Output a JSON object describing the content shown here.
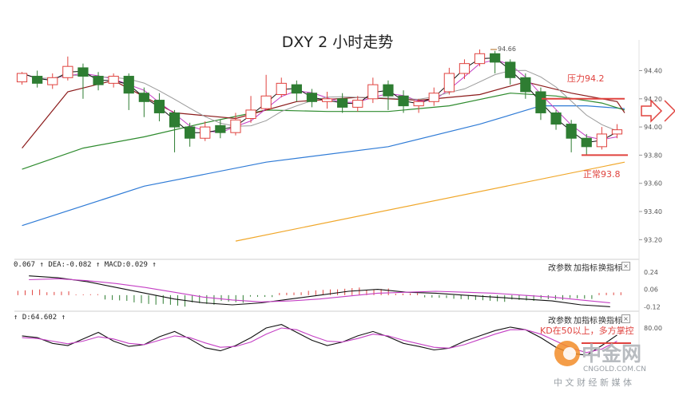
{
  "title": "DXY 2 小时走势",
  "macd_panel": {
    "values_text": "0.067 ↑ DEA:-0.082 ↑ MACD:0.029 ↑",
    "buttons": [
      "改参数",
      "加指标",
      "换指标"
    ],
    "close_symbol": "×",
    "ticks": [
      "0.24",
      "0.06",
      "-0.12"
    ]
  },
  "kd_panel": {
    "values_text": "↑ D:64.602 ↑",
    "buttons": [
      "改参数",
      "加指标",
      "换指标"
    ],
    "close_symbol": "×",
    "ticks": [
      "80.00"
    ]
  },
  "annotations": {
    "resistance": "压力94.2",
    "support": "正常93.8",
    "kd_note": "KD在50以上，多方掌控",
    "high_label": "94.66"
  },
  "watermark": {
    "brand": "中金网",
    "domain": "CNGOLD.COM.CN",
    "tagline": "中 文 财 经 新 媒 体"
  },
  "colors": {
    "up": "#e0433f",
    "down": "#2e7d32",
    "ma_blue": "#2f7bd6",
    "ma_orange": "#f0a72a",
    "ma_green": "#2e8b2e",
    "ma_dark_red": "#8b1a1a",
    "ma_pink": "#c43fc4",
    "ma_gray": "#9a9a9a",
    "annotation": "#e0433f"
  },
  "chart_data": {
    "type": "line",
    "title": "DXY 2 小时走势",
    "ylim": [
      93.1,
      94.55
    ],
    "y_ticks": [
      94.4,
      94.2,
      94.0,
      93.8,
      93.6,
      93.4,
      93.2
    ],
    "y_tick_labels": [
      "94.40",
      "94.20",
      "94.00",
      "93.80",
      "93.60",
      "93.40",
      "93.20"
    ],
    "series": [
      {
        "key": "ma_orange",
        "x": [
          14,
          40
        ],
        "values": [
          93.19,
          93.75
        ]
      },
      {
        "key": "ma_blue",
        "x": [
          0,
          8,
          16,
          24,
          30,
          34,
          37,
          40
        ],
        "values": [
          93.3,
          93.58,
          93.75,
          93.86,
          94.02,
          94.15,
          94.15,
          94.13
        ]
      },
      {
        "key": "ma_green",
        "x": [
          0,
          4,
          8,
          12,
          16,
          20,
          24,
          28,
          32,
          35,
          38,
          40
        ],
        "values": [
          93.7,
          93.85,
          93.93,
          94.03,
          94.12,
          94.11,
          94.11,
          94.15,
          94.24,
          94.22,
          94.17,
          94.12
        ]
      },
      {
        "key": "ma_dark_red",
        "x": [
          0,
          3,
          6,
          10,
          14,
          18,
          22,
          26,
          30,
          33,
          36,
          39,
          40
        ],
        "values": [
          93.85,
          94.25,
          94.33,
          94.1,
          94.06,
          94.18,
          94.21,
          94.19,
          94.23,
          94.32,
          94.24,
          94.18,
          94.1
        ]
      }
    ],
    "candles": [
      [
        94.32,
        94.38,
        94.3,
        94.39
      ],
      [
        94.36,
        94.31,
        94.28,
        94.4
      ],
      [
        94.3,
        94.35,
        94.27,
        94.38
      ],
      [
        94.35,
        94.43,
        94.33,
        94.5
      ],
      [
        94.42,
        94.36,
        94.2,
        94.45
      ],
      [
        94.36,
        94.3,
        94.26,
        94.39
      ],
      [
        94.31,
        94.36,
        94.28,
        94.38
      ],
      [
        94.36,
        94.24,
        94.12,
        94.38
      ],
      [
        94.24,
        94.18,
        94.07,
        94.28
      ],
      [
        94.19,
        94.1,
        94.04,
        94.24
      ],
      [
        94.1,
        94.0,
        93.82,
        94.12
      ],
      [
        94.0,
        93.92,
        93.86,
        94.03
      ],
      [
        93.92,
        94.0,
        93.9,
        94.04
      ],
      [
        94.01,
        93.96,
        93.92,
        94.05
      ],
      [
        93.96,
        94.05,
        93.94,
        94.1
      ],
      [
        94.06,
        94.12,
        94.03,
        94.22
      ],
      [
        94.13,
        94.22,
        94.12,
        94.37
      ],
      [
        94.23,
        94.31,
        94.21,
        94.35
      ],
      [
        94.3,
        94.24,
        94.18,
        94.33
      ],
      [
        94.24,
        94.18,
        94.14,
        94.27
      ],
      [
        94.18,
        94.2,
        94.13,
        94.25
      ],
      [
        94.2,
        94.14,
        94.1,
        94.24
      ],
      [
        94.14,
        94.19,
        94.11,
        94.22
      ],
      [
        94.2,
        94.3,
        94.17,
        94.35
      ],
      [
        94.3,
        94.22,
        94.12,
        94.33
      ],
      [
        94.22,
        94.15,
        94.1,
        94.26
      ],
      [
        94.15,
        94.18,
        94.1,
        94.2
      ],
      [
        94.18,
        94.24,
        94.15,
        94.28
      ],
      [
        94.25,
        94.38,
        94.23,
        94.42
      ],
      [
        94.38,
        94.45,
        94.34,
        94.48
      ],
      [
        94.45,
        94.52,
        94.43,
        94.55
      ],
      [
        94.52,
        94.46,
        94.38,
        94.54
      ],
      [
        94.46,
        94.35,
        94.3,
        94.48
      ],
      [
        94.35,
        94.25,
        94.2,
        94.38
      ],
      [
        94.25,
        94.1,
        94.05,
        94.28
      ],
      [
        94.1,
        94.02,
        93.98,
        94.12
      ],
      [
        94.02,
        93.92,
        93.82,
        94.05
      ],
      [
        93.92,
        93.86,
        93.8,
        93.95
      ],
      [
        93.86,
        93.95,
        93.84,
        94.0
      ],
      [
        93.95,
        93.98,
        93.92,
        94.02
      ]
    ],
    "macd": {
      "ylim": [
        -0.15,
        0.28
      ],
      "dif": [
        0.2,
        0.18,
        0.14,
        0.08,
        0.02,
        -0.04,
        -0.08,
        -0.1,
        -0.08,
        -0.04,
        0.0,
        0.04,
        0.06,
        0.03,
        0.02,
        0.0,
        -0.02,
        -0.04,
        -0.06,
        -0.1,
        -0.12
      ],
      "dea": [
        0.16,
        0.17,
        0.15,
        0.12,
        0.08,
        0.03,
        -0.02,
        -0.05,
        -0.07,
        -0.06,
        -0.04,
        -0.01,
        0.02,
        0.03,
        0.04,
        0.03,
        0.02,
        0.0,
        -0.02,
        -0.05,
        -0.08
      ],
      "hist": [
        0.06,
        0.04,
        0.01,
        -0.06,
        -0.1,
        -0.12,
        -0.1,
        -0.08,
        -0.02,
        0.03,
        0.06,
        0.08,
        0.07,
        0.02,
        -0.03,
        -0.05,
        -0.07,
        -0.06,
        -0.05,
        -0.04,
        0.03
      ]
    },
    "kd": {
      "ylim": [
        0,
        100
      ],
      "k": [
        62,
        58,
        45,
        40,
        55,
        70,
        50,
        38,
        42,
        60,
        72,
        55,
        35,
        28,
        40,
        58,
        80,
        88,
        70,
        52,
        40,
        48,
        62,
        72,
        60,
        45,
        38,
        30,
        34,
        50,
        62,
        74,
        82,
        76,
        58,
        36,
        22,
        18,
        40,
        64
      ],
      "d": [
        58,
        56,
        50,
        44,
        50,
        60,
        55,
        45,
        42,
        52,
        62,
        58,
        46,
        36,
        38,
        48,
        66,
        80,
        76,
        62,
        50,
        48,
        56,
        66,
        62,
        52,
        44,
        36,
        34,
        42,
        54,
        66,
        76,
        76,
        66,
        50,
        34,
        24,
        32,
        50
      ]
    }
  }
}
